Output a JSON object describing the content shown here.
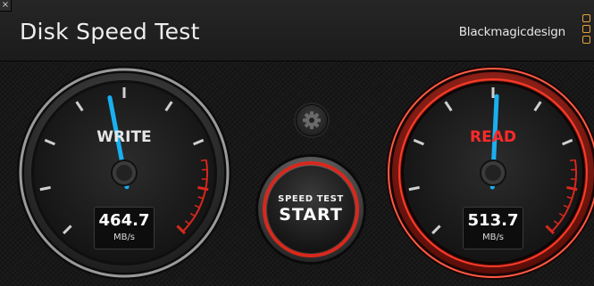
{
  "window": {
    "close_glyph": "×",
    "title": "Disk Speed Test",
    "brand": "Blackmagicdesign"
  },
  "write_gauge": {
    "label": "WRITE",
    "value": "464.7",
    "unit": "MB/s",
    "needle_fraction": 0.46,
    "label_color": "#e6e6e6",
    "needle_color": "#1ab0f0"
  },
  "read_gauge": {
    "label": "READ",
    "value": "513.7",
    "unit": "MB/s",
    "needle_fraction": 0.51,
    "label_color": "#ff2a2a",
    "needle_color": "#1ab0f0"
  },
  "controls": {
    "settings_icon": "gear-icon",
    "start_small": "SPEED TEST",
    "start_big": "START"
  },
  "colors": {
    "accent_red": "#d8281c",
    "brand_orange": "#e8a23a"
  }
}
